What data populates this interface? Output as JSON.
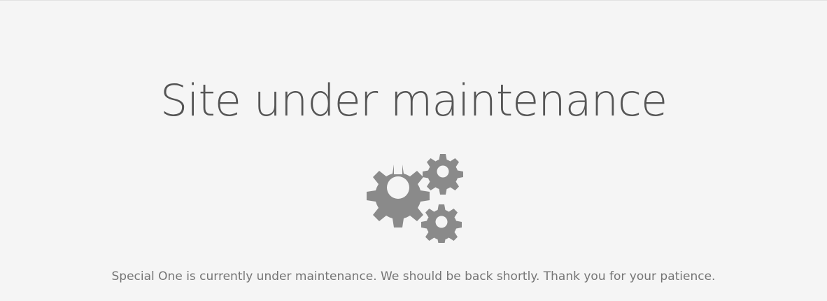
{
  "page": {
    "title": "Site under maintenance",
    "message": "Special One is currently under maintenance. We should be back shortly. Thank you for your patience."
  },
  "icon": {
    "name": "gears-icon",
    "color": "#8a8a8a"
  },
  "colors": {
    "background": "#f5f5f5",
    "title": "#555555",
    "message": "#757575"
  }
}
